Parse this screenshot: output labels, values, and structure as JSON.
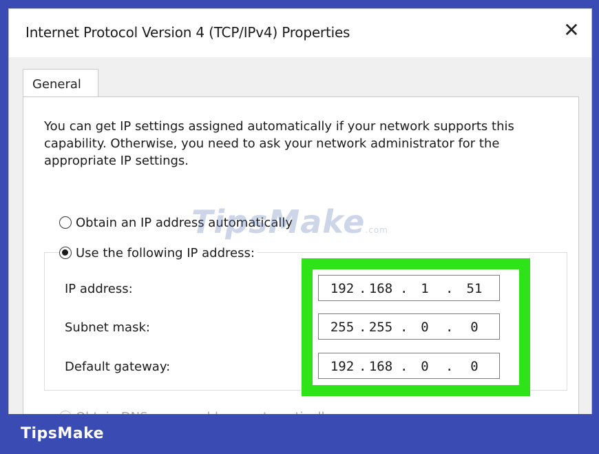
{
  "dialog": {
    "title": "Internet Protocol Version 4 (TCP/IPv4) Properties",
    "close_glyph": "✕"
  },
  "tabs": [
    {
      "label": "General",
      "active": true
    }
  ],
  "description": "You can get IP settings assigned automatically if your network supports this capability. Otherwise, you need to ask your network administrator for the appropriate IP settings.",
  "ip_options": {
    "auto": {
      "label": "Obtain an IP address automatically",
      "selected": false
    },
    "manual": {
      "label": "Use the following IP address:",
      "selected": true
    }
  },
  "fields": {
    "ip_address": {
      "label": "IP address:",
      "octets": [
        "192",
        "168",
        "1",
        "51"
      ]
    },
    "subnet_mask": {
      "label": "Subnet mask:",
      "octets": [
        "255",
        "255",
        "0",
        "0"
      ]
    },
    "default_gateway": {
      "label": "Default gateway:",
      "octets": [
        "192",
        "168",
        "0",
        "0"
      ]
    }
  },
  "dns_options": {
    "auto": {
      "label": "Obtain DNS server address automatically",
      "enabled": false
    }
  },
  "watermark": {
    "text": "TipsMake",
    "suffix": ".com"
  },
  "footer": {
    "brand": "TipsMake"
  },
  "colors": {
    "frame": "#3a4cb4",
    "highlight": "#2ee318"
  }
}
